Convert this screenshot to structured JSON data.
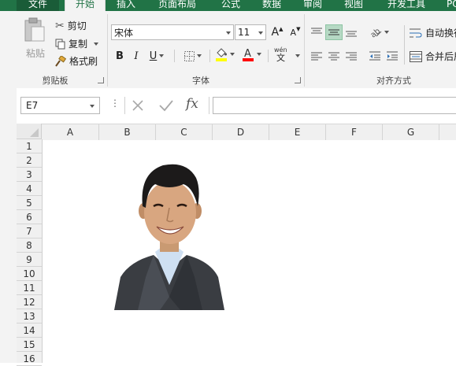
{
  "tabs": {
    "file": "文件",
    "home": "开始",
    "insert": "插入",
    "page_layout": "页面布局",
    "formulas": "公式",
    "data": "数据",
    "review": "审阅",
    "view": "视图",
    "developer": "开发工具",
    "extra": "PO"
  },
  "clipboard": {
    "paste": "粘贴",
    "cut": "剪切",
    "copy": "复制",
    "format_painter": "格式刷",
    "group_label": "剪贴板"
  },
  "font": {
    "name": "宋体",
    "size": "11",
    "bold": "B",
    "italic": "I",
    "underline": "U",
    "grow": "A",
    "shrink": "A",
    "phonetic_top": "wén",
    "phonetic_bottom": "文",
    "group_label": "字体"
  },
  "alignment": {
    "wrap_text": "自动换行",
    "merge_center": "合并后居中",
    "group_label": "对齐方式"
  },
  "formula_bar": {
    "name_box": "E7",
    "fx": "fx",
    "formula": ""
  },
  "grid": {
    "columns": [
      "A",
      "B",
      "C",
      "D",
      "E",
      "F",
      "G"
    ],
    "rows": [
      "1",
      "2",
      "3",
      "4",
      "5",
      "6",
      "7",
      "8",
      "9",
      "10",
      "11",
      "12",
      "13",
      "14",
      "15",
      "16"
    ]
  },
  "colors": {
    "accent": "#217346",
    "fill_highlight": "#ffff00",
    "font_color": "#ff0000",
    "selected_button": "#b6d9c4"
  }
}
